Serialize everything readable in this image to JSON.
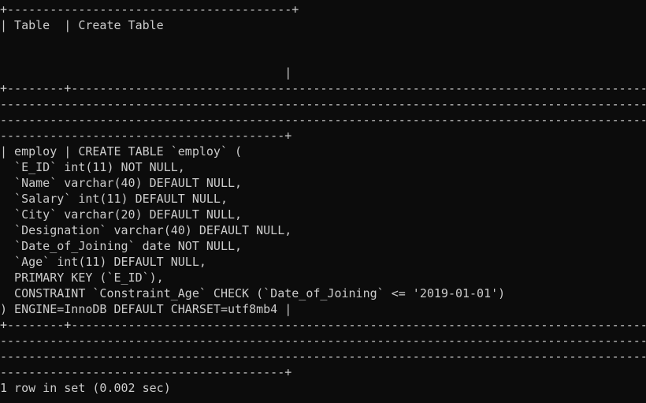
{
  "terminal": {
    "app": "mysql-client",
    "background_color": "#0c0c0c",
    "foreground_color": "#cccccc",
    "columns": 85,
    "rows": 25,
    "lines": [
      "+----------------------------------------+",
      "| Table  | Create Table",
      "",
      "",
      "                                        |",
      "+--------+-------------------------------------------------------------------------------------",
      "---------------------------------------------------------------------------------------------",
      "---------------------------------------------------------------------------------------------",
      "----------------------------------------+",
      "| employ | CREATE TABLE `employ` (",
      "  `E_ID` int(11) NOT NULL,",
      "  `Name` varchar(40) DEFAULT NULL,",
      "  `Salary` int(11) DEFAULT NULL,",
      "  `City` varchar(20) DEFAULT NULL,",
      "  `Designation` varchar(40) DEFAULT NULL,",
      "  `Date_of_Joining` date NOT NULL,",
      "  `Age` int(11) DEFAULT NULL,",
      "  PRIMARY KEY (`E_ID`),",
      "  CONSTRAINT `Constraint_Age` CHECK (`Date_of_Joining` <= '2019-01-01')",
      ") ENGINE=InnoDB DEFAULT CHARSET=utf8mb4 |",
      "+--------+-------------------------------------------------------------------------------------",
      "---------------------------------------------------------------------------------------------",
      "---------------------------------------------------------------------------------------------",
      "----------------------------------------+",
      "1 row in set (0.002 sec)"
    ],
    "result_table": {
      "headers": [
        "Table",
        "Create Table"
      ],
      "rows": [
        {
          "Table": "employ",
          "Create Table": "CREATE TABLE `employ` (\n  `E_ID` int(11) NOT NULL,\n  `Name` varchar(40) DEFAULT NULL,\n  `Salary` int(11) DEFAULT NULL,\n  `City` varchar(20) DEFAULT NULL,\n  `Designation` varchar(40) DEFAULT NULL,\n  `Date_of_Joining` date NOT NULL,\n  `Age` int(11) DEFAULT NULL,\n  PRIMARY KEY (`E_ID`),\n  CONSTRAINT `Constraint_Age` CHECK (`Date_of_Joining` <= '2019-01-01')\n) ENGINE=InnoDB DEFAULT CHARSET=utf8mb4"
        }
      ]
    },
    "ddl_lines": [
      "CREATE TABLE `employ` (",
      "  `E_ID` int(11) NOT NULL,",
      "  `Name` varchar(40) DEFAULT NULL,",
      "  `Salary` int(11) DEFAULT NULL,",
      "  `City` varchar(20) DEFAULT NULL,",
      "  `Designation` varchar(40) DEFAULT NULL,",
      "  `Date_of_Joining` date NOT NULL,",
      "  `Age` int(11) DEFAULT NULL,",
      "  PRIMARY KEY (`E_ID`),",
      "  CONSTRAINT `Constraint_Age` CHECK (`Date_of_Joining` <= '2019-01-01')",
      ") ENGINE=InnoDB DEFAULT CHARSET=utf8mb4"
    ],
    "status_line": "1 row in set (0.002 sec)",
    "row_count": "1",
    "duration": "0.002 sec"
  }
}
